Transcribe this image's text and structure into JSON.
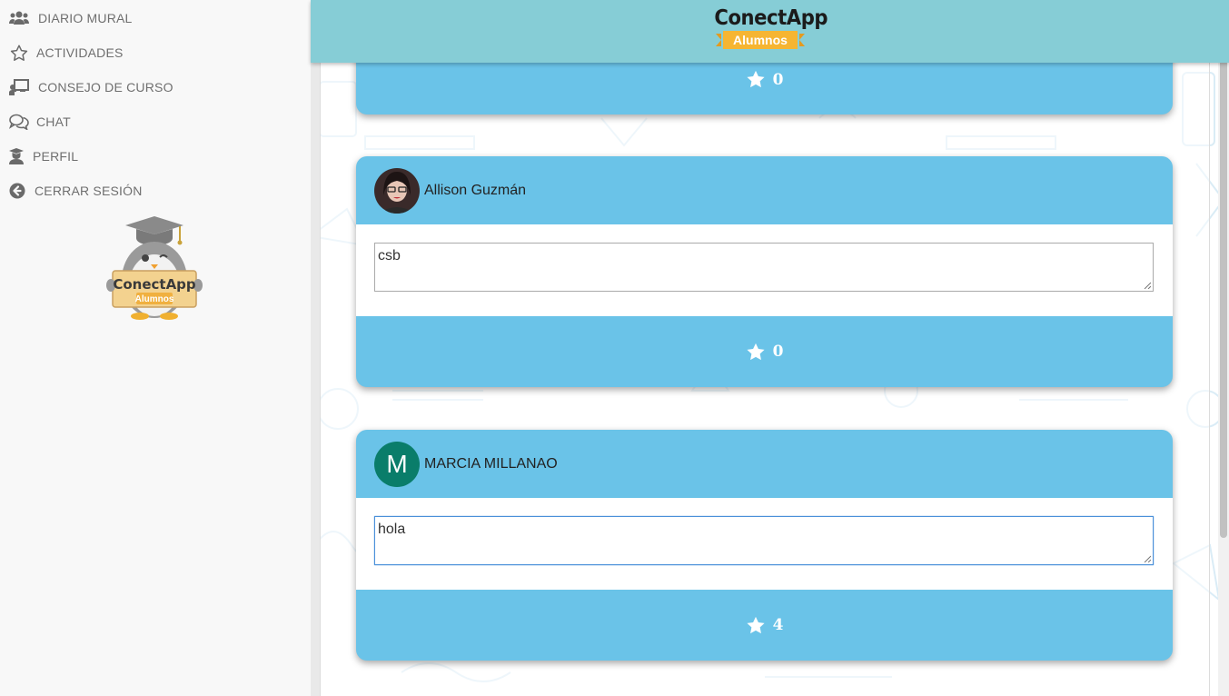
{
  "sidebar": {
    "items": [
      {
        "label": "DIARIO MURAL",
        "icon": "users-icon"
      },
      {
        "label": "ACTIVIDADES",
        "icon": "star-outline-icon"
      },
      {
        "label": "CONSEJO DE CURSO",
        "icon": "chalkboard-teacher-icon"
      },
      {
        "label": "CHAT",
        "icon": "comments-icon"
      },
      {
        "label": "PERFIL",
        "icon": "user-graduate-icon"
      },
      {
        "label": "CERRAR SESIÓN",
        "icon": "arrow-circle-left-icon"
      }
    ],
    "logo": {
      "title": "ConectApp",
      "subtitle": "Alumnos"
    }
  },
  "header": {
    "brand_title": "ConectApp",
    "brand_subtitle": "Alumnos"
  },
  "posts": [
    {
      "author": "",
      "text": "",
      "stars": "0",
      "partial": true
    },
    {
      "author": "Allison Guzmán",
      "avatar": "photo",
      "text": "csb",
      "stars": "0"
    },
    {
      "author": "MARCIA MILLANAO",
      "avatar_letter": "M",
      "text": "hola",
      "stars": "4"
    }
  ],
  "colors": {
    "header_bg": "#86cdd6",
    "card_bg": "#6ac3e8",
    "avatar_letter_bg": "#0a7d6a",
    "ribbon": "#f6b532"
  }
}
